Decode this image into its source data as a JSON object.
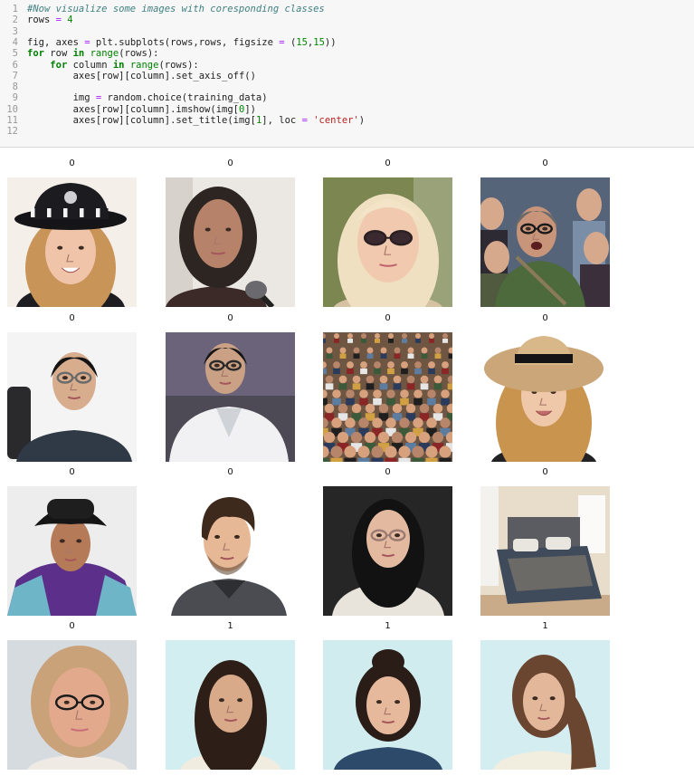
{
  "code_cell": {
    "lines": [
      {
        "no": "1",
        "text": "#Now visualize some images with coresponding classes"
      },
      {
        "no": "2",
        "text": "rows = 4"
      },
      {
        "no": "3",
        "text": ""
      },
      {
        "no": "4",
        "text": "fig, axes = plt.subplots(rows,rows, figsize = (15,15))"
      },
      {
        "no": "5",
        "text": "for row in range(rows):"
      },
      {
        "no": "6",
        "text": "    for column in range(rows):"
      },
      {
        "no": "7",
        "text": "        axes[row][column].set_axis_off()"
      },
      {
        "no": "8",
        "text": ""
      },
      {
        "no": "9",
        "text": "        img = random.choice(training_data)"
      },
      {
        "no": "10",
        "text": "        axes[row][column].imshow(img[0])"
      },
      {
        "no": "11",
        "text": "        axes[row][column].set_title(img[1], loc = 'center')"
      },
      {
        "no": "12",
        "text": ""
      }
    ]
  },
  "output": {
    "subplots": [
      {
        "title": "0",
        "scene": "woman-police-cap",
        "bg": "#f3eee8"
      },
      {
        "title": "0",
        "scene": "woman-speaking-mic",
        "bg": "#e9e6e2"
      },
      {
        "title": "0",
        "scene": "blonde-sunglasses",
        "bg": "#7f8a56"
      },
      {
        "title": "0",
        "scene": "crowd-man-shouting",
        "bg": "#5d6b7c"
      },
      {
        "title": "0",
        "scene": "man-glasses-office",
        "bg": "#f4f4f4"
      },
      {
        "title": "0",
        "scene": "man-lab-coat",
        "bg": "#6a6278"
      },
      {
        "title": "0",
        "scene": "stadium-crowd",
        "bg": "#8a6b52"
      },
      {
        "title": "0",
        "scene": "woman-sun-hat",
        "bg": "#ffffff"
      },
      {
        "title": "0",
        "scene": "man-bucket-hat",
        "bg": "#ececec"
      },
      {
        "title": "0",
        "scene": "cartoon-man",
        "bg": "#ffffff"
      },
      {
        "title": "0",
        "scene": "woman-glasses-portrait",
        "bg": "#2a2a2a"
      },
      {
        "title": "0",
        "scene": "bedroom",
        "bg": "#e9ddcd"
      },
      {
        "title": "0",
        "scene": "older-woman-glasses",
        "bg": "#d7dde3"
      },
      {
        "title": "1",
        "scene": "woman-id-photo-1",
        "bg": "#d3eef0"
      },
      {
        "title": "1",
        "scene": "woman-id-photo-2",
        "bg": "#d1edf0"
      },
      {
        "title": "1",
        "scene": "woman-id-photo-3",
        "bg": "#d5eef1"
      }
    ]
  }
}
